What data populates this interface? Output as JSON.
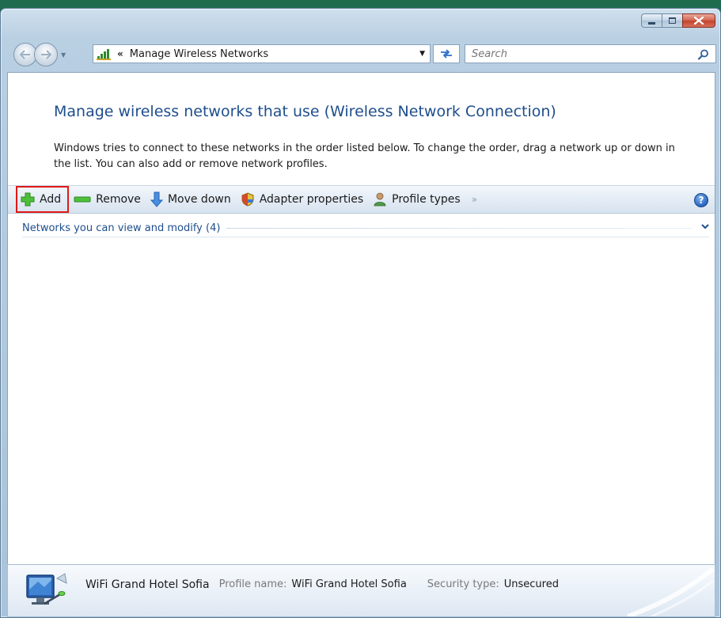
{
  "window": {
    "caption_buttons": {
      "minimize": "minimize",
      "maximize": "maximize",
      "close": "close"
    }
  },
  "address_bar": {
    "chevron": "«",
    "path": "Manage Wireless Networks",
    "search_placeholder": "Search"
  },
  "page": {
    "heading": "Manage wireless networks that use (Wireless Network Connection)",
    "description": "Windows tries to connect to these networks in the order listed below. To change the order, drag a network up or down in the list. You can also add or remove network profiles."
  },
  "toolbar": {
    "add_label": "Add",
    "remove_label": "Remove",
    "move_down_label": "Move down",
    "adapter_properties_label": "Adapter properties",
    "profile_types_label": "Profile types",
    "more_glyph": "»",
    "help_glyph": "?"
  },
  "group": {
    "header": "Networks you can view and modify (4)"
  },
  "details": {
    "network_name": "WiFi Grand Hotel Sofia",
    "profile_name_label": "Profile name:",
    "profile_name_value": "WiFi Grand Hotel Sofia",
    "security_type_label": "Security type:",
    "security_type_value": "Unsecured"
  },
  "colors": {
    "heading": "#1e4e8c",
    "highlight_box": "#e01818",
    "close_button": "#c0432c"
  }
}
